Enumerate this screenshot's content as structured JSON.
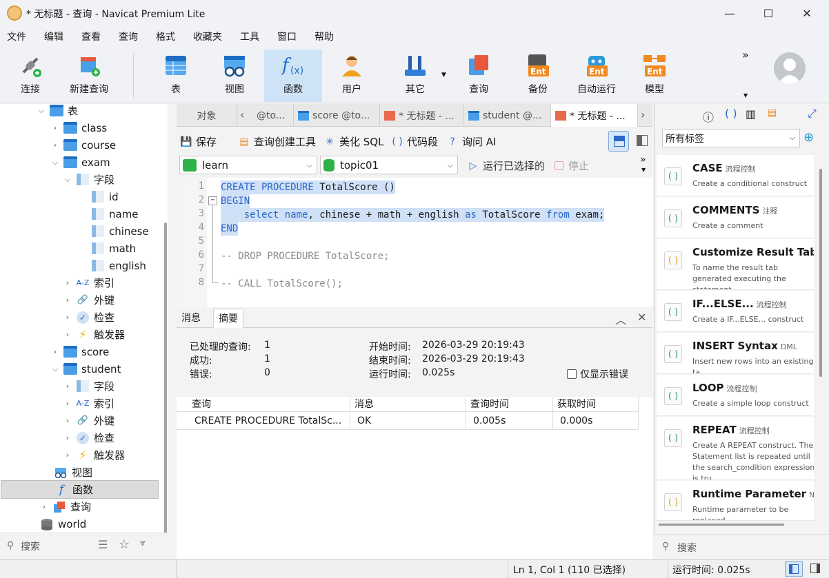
{
  "window": {
    "title": "* 无标题 - 查询 - Navicat Premium Lite",
    "minimize": "—",
    "maximize": "☐",
    "close": "✕"
  },
  "menu": [
    "文件",
    "编辑",
    "查看",
    "查询",
    "格式",
    "收藏夹",
    "工具",
    "窗口",
    "帮助"
  ],
  "toolbar": {
    "connect": "连接",
    "new_query": "新建查询",
    "table": "表",
    "view": "视图",
    "function": "函数",
    "user": "用户",
    "other": "其它",
    "query": "查询",
    "backup": "备份",
    "auto_run": "自动运行",
    "model": "模型",
    "more": "»"
  },
  "tree": {
    "tables": "表",
    "class": "class",
    "course": "course",
    "exam": "exam",
    "fields": "字段",
    "id": "id",
    "name": "name",
    "chinese": "chinese",
    "math": "math",
    "english": "english",
    "index": "索引",
    "fk": "外键",
    "check": "检查",
    "trigger": "触发器",
    "score": "score",
    "student": "student",
    "views": "视图",
    "functions": "函数",
    "queries": "查询",
    "world": "world",
    "az": "A-Z"
  },
  "nav_search": {
    "label": "搜索"
  },
  "tabs": {
    "objects": "对象",
    "t1": "@to...",
    "t2": "score @to...",
    "t3": "* 无标题 - ...",
    "t4": "student @...",
    "t5": "* 无标题 - ..."
  },
  "query_toolbar": {
    "save": "保存",
    "builder": "查询创建工具",
    "beautify": "美化 SQL",
    "snippet": "代码段",
    "ask_ai": "询问 AI"
  },
  "selectors": {
    "connection": "learn",
    "database": "topic01",
    "run": "运行已选择的",
    "stop": "停止"
  },
  "editor": {
    "line_numbers": [
      "1",
      "2",
      "3",
      "4",
      "5",
      "6",
      "7",
      "8"
    ],
    "l1a": "CREATE PROCEDURE",
    "l1b": " TotalScore ()",
    "l2": "BEGIN",
    "l3a": "    select",
    "l3b": " name",
    "l3c": ", chinese + math + english ",
    "l3d": "as",
    "l3e": " TotalScore ",
    "l3f": "from",
    "l3g": " exam;",
    "l4": "END",
    "l6": "-- DROP PROCEDURE TotalScore;",
    "l8": "-- CALL TotalScore();"
  },
  "result_tabs": {
    "messages": "消息",
    "summary": "摘要"
  },
  "summary": {
    "processed_label": "已处理的查询:",
    "processed": "1",
    "success_label": "成功:",
    "success": "1",
    "errors_label": "错误:",
    "errors": "0",
    "start_label": "开始时间:",
    "start": "2026-03-29 20:19:43",
    "end_label": "结束时间:",
    "end": "2026-03-29 20:19:43",
    "elapsed_label": "运行时间:",
    "elapsed": "0.025s",
    "only_errors": "仅显示错误"
  },
  "result_table": {
    "headers": [
      "查询",
      "消息",
      "查询时间",
      "获取时间"
    ],
    "row": [
      "CREATE PROCEDURE TotalSc...",
      "OK",
      "0.005s",
      "0.000s"
    ]
  },
  "right_panel": {
    "tag_select": "所有标签",
    "snippets": [
      {
        "title": "CASE",
        "tag": "流程控制",
        "desc": "Create a conditional construct"
      },
      {
        "title": "COMMENTS",
        "tag": "注释",
        "desc": "Create a comment"
      },
      {
        "title": "Customize Result Tab",
        "tag": "",
        "desc": "To name the result tab generated executing the statement."
      },
      {
        "title": "IF...ELSE...",
        "tag": "流程控制",
        "desc": "Create a IF...ELSE... construct"
      },
      {
        "title": "INSERT Syntax",
        "tag": "DML",
        "desc": "Insert new rows into an existing ta"
      },
      {
        "title": "LOOP",
        "tag": "流程控制",
        "desc": "Create a simple loop construct"
      },
      {
        "title": "REPEAT",
        "tag": "流程控制",
        "desc": "Create A REPEAT construct. The Statement list is repeated until the search_condition expression is tru"
      },
      {
        "title": "Runtime Parameter",
        "tag": "Na",
        "desc": "Runtime parameter to be replaced"
      }
    ],
    "search": "搜索"
  },
  "status": {
    "cursor": "Ln 1, Col 1 (110 已选择)",
    "elapsed": "运行时间: 0.025s"
  },
  "colors": {
    "accent": "#2a67c8",
    "selection": "#cfe0f7",
    "active_tool": "#cfe3f7"
  }
}
